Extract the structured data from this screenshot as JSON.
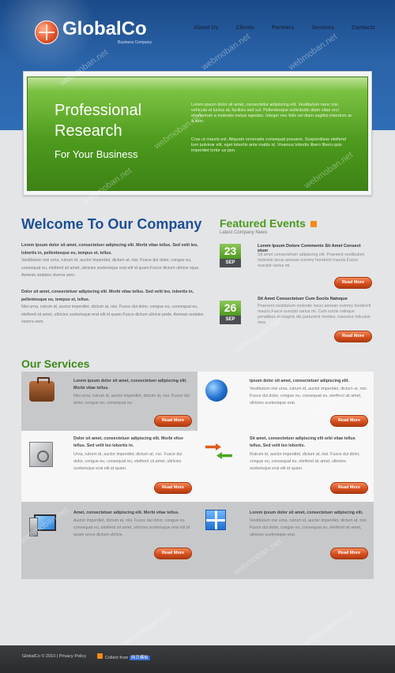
{
  "brand": {
    "name": "GlobalCo",
    "tagline": "Business Company"
  },
  "nav": [
    "About Us",
    "Clients",
    "Partners",
    "Services",
    "Contacts"
  ],
  "banner": {
    "heading": "Professional\nResearch",
    "subheading": "For Your Business",
    "para1": "Lorem ipsum dolor sit amet, consectetur adipiscing elit. Vestibulum nunc nisi, vehicula et luctus at, facilisis sed sul. Pellentesque sollicitudin diam vitae orci elementum a molestie metus egestas. Integer nec felis vel diam sagittis interdum ac a sem.",
    "para2": "Cras ut mauris est. Aliquam venenatis consequat posuere. Suspendisse eleifend tum pulvinar elit, eget lobortis ante mattis id. Vivamus lobortis libero libero,quis imperdiet tortor us pen."
  },
  "welcome": {
    "title": "Welcome To Our Company",
    "p1_bold": "Lorem ipsum dolor sit amet, consectetuer adipiscing elit. Morbi vitae tellus. Sed velit leo, lobortis in, pellentesque eu, tempus et, tellus.",
    "p1": "Vestibulum nisi urna, rutrum id, auctor imperdiet, dictum at, nisi. Fusce dui dolor, congue eu, consequat eu, eleifend sit amet, ultricies scelerisque erat elit id quam.Fusce dictum ultricie sque. Aenean sodales viverra sem.",
    "p2_bold": "Dolor sit amet, consectetuer adipiscing elit. Morbi vitae tellus. Sed velit leo, lobortis in, pellentesque eu, tempus et, tellus.",
    "p2": "Nisi urna, rutrum id, auctor imperdiet, dictum at, nisi. Fusce dui dolor, congue eu, consequat eu, eleifend sit amet, ultricies scelerisque erat elit id quam.Fusce dictum ultricie pede. Aenean sodales viverra sem."
  },
  "featured": {
    "title": "Featured Events",
    "subtitle": "Latest Company News",
    "events": [
      {
        "day": "23",
        "month": "SEP",
        "title": "Lorem Ipsum Dolore Commento Sit Amet Consect etuer",
        "text": "Sit amet consectetuer adipiscing elit. Praesent vestibulum molestie lacus aenean nummy hendrerit mauris.Fusce suscipit varius mi.",
        "button": "Read More"
      },
      {
        "day": "26",
        "month": "SEP",
        "title": "Sit Amet Consectetuer Cum Sociis Natoque",
        "text": "Praesent vestibulum molestie lacus aenean nummy hendrerit mauris.Fusce suscipit varius mi. Cum sociis natoque penatibus et magnis dis parturient montes, nascetur ridiculus mus.",
        "button": "Read More"
      }
    ]
  },
  "services": {
    "title": "Our Services",
    "items": [
      {
        "icon": "briefcase-icon",
        "title": "Lorem ipsum dolor sit amet, consectetuer adipiscing elit. Morbi vitae tellus.",
        "body": "Nisi urna, rutrum id, auctor imperdiet, dictum at, nisi. Fusce dui dolor, congue eu, consequat eu",
        "button": "Read More"
      },
      {
        "icon": "globe-icon",
        "title": "Ipsum dolor sit amet, consectetuer adipiscing elit.",
        "body": "Vestibulum nisi urna, rutrum id, auctor imperdiet, dictum at, nisi. Fusce dui dolor, congue eu, consequat eu, eleifend sit amet, ultricies scelerisque erat.",
        "button": "Read More"
      },
      {
        "icon": "safe-icon",
        "title": "Dolor sit amet, consectetuer adipiscing elit. Morbi vitae tellus. Sed velit leo lobortis in.",
        "body": "Urna, rutrum id, auctor imperdiet, dictum at, nisi. Fusce dui dolor, congue eu, consequat eu, eleifend sit amet, ultricies scelerisque erat elit id quam.",
        "button": "Read More"
      },
      {
        "icon": "arrows-icon",
        "title": "Sit amet, consectetuer adipiscing elit orbi vitae tellus tellus. Sed velit leo lobortis.",
        "body": "Rutrum id, auctor imperdiet, dictum at, nisi. Fusce dui dolor, congue eu, consequat eu, eleifend sit amet, ultricies scelerisque erat elit id quam.",
        "button": "Read More"
      },
      {
        "icon": "computer-icon",
        "title": "Amet, consectetuer adipiscing elit. Morbi vitae tellus.",
        "body": "Auctor imperdiet, dictum at, nisi. Fusce dui dolor, congue eu, consequat eu, eleifend sit amet, ultricies scelerisque erat elit id quam ursce dictum ultricie.",
        "button": "Read More"
      },
      {
        "icon": "gift-icon",
        "title": "Lorem ipsum dolor sit amet, consectetuer adipiscing elit.",
        "body": "Vestibulum nisi urna, rutrum id, auctor imperdiet, dictum at, nisi. Fusce dui dolor, congue eu, consequat eu, eleifend sit amet, ultricies scelerisque erat.",
        "button": "Read More"
      }
    ]
  },
  "footer": {
    "copyright": "GlobalCo © 2010 | ",
    "privacy": "Privacy Policy",
    "collect_label": "Collect from ",
    "collect_link": "网页模板"
  },
  "watermark": "webmoban.net"
}
